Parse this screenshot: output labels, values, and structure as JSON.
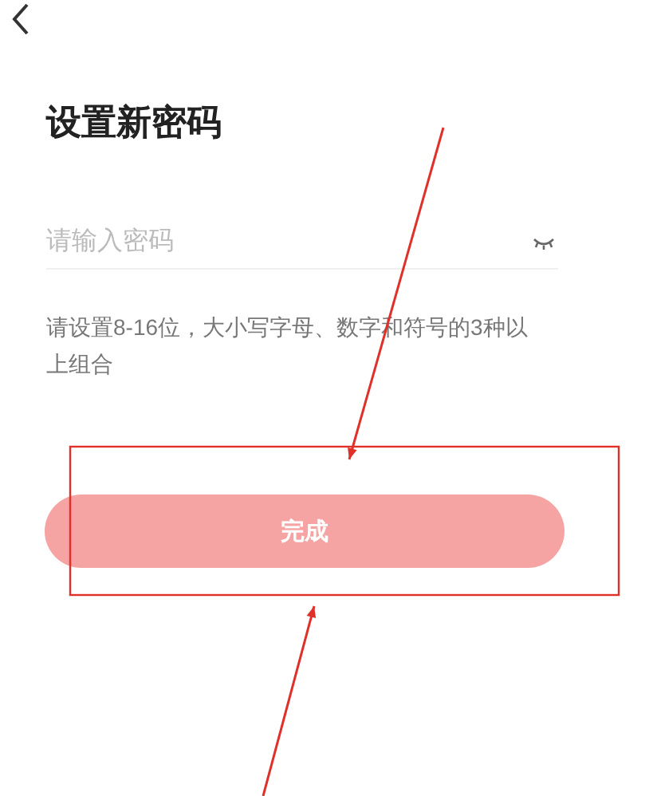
{
  "title": "设置新密码",
  "password_field": {
    "placeholder": "请输入密码",
    "visible": false
  },
  "hint": "请设置8-16位，大小写字母、数字和符号的3种以上组合",
  "submit_button": {
    "label": "完成",
    "disabled": true
  },
  "annotations": [
    {
      "kind": "arrow"
    },
    {
      "kind": "box"
    },
    {
      "kind": "arrow"
    }
  ]
}
